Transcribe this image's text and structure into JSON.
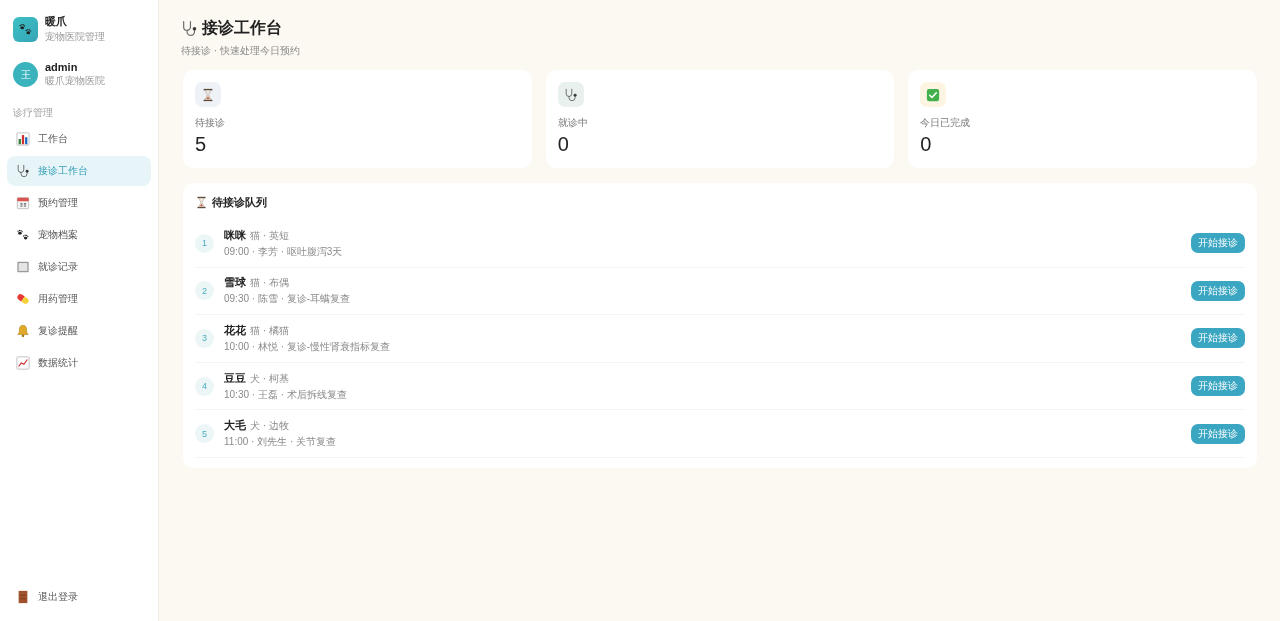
{
  "sidebar": {
    "brand": {
      "name": "暖爪",
      "subtitle": "宠物医院管理"
    },
    "user": {
      "avatar": "王",
      "name": "admin",
      "org": "暖爪宠物医院"
    },
    "section_label": "诊疗管理",
    "items": [
      {
        "kind": "bar-chart",
        "label": "工作台",
        "selected": false
      },
      {
        "kind": "stethoscope",
        "label": "接诊工作台",
        "selected": true
      },
      {
        "kind": "calendar",
        "label": "预约管理",
        "selected": false
      },
      {
        "kind": "paws",
        "label": "宠物档案",
        "selected": false
      },
      {
        "kind": "notebook",
        "label": "就诊记录",
        "selected": false
      },
      {
        "kind": "pill",
        "label": "用药管理",
        "selected": false
      },
      {
        "kind": "bell",
        "label": "复诊提醒",
        "selected": false
      },
      {
        "kind": "line-chart",
        "label": "数据统计",
        "selected": false
      }
    ],
    "logout": {
      "label": "退出登录"
    }
  },
  "page": {
    "title": "接诊工作台",
    "subtitle": "待接诊 · 快速处理今日预约"
  },
  "stats": [
    {
      "kind": "hourglass",
      "label": "待接诊",
      "value": "5"
    },
    {
      "kind": "stethoscope",
      "label": "就诊中",
      "value": "0"
    },
    {
      "kind": "check",
      "label": "今日已完成",
      "value": "0"
    }
  ],
  "queue": {
    "title": "待接诊队列",
    "rows": [
      {
        "number": "1",
        "name": "咪咪",
        "species": "猫 · 英短",
        "details": "09:00 · 李芳 · 呕吐腹泻3天",
        "button": "开始接诊"
      },
      {
        "number": "2",
        "name": "雪球",
        "species": "猫 · 布偶",
        "details": "09:30 · 陈雪 · 复诊-耳螨复查",
        "button": "开始接诊"
      },
      {
        "number": "3",
        "name": "花花",
        "species": "猫 · 橘猫",
        "details": "10:00 · 林悦 · 复诊-慢性肾衰指标复查",
        "button": "开始接诊"
      },
      {
        "number": "4",
        "name": "豆豆",
        "species": "犬 · 柯基",
        "details": "10:30 · 王磊 · 术后拆线复查",
        "button": "开始接诊"
      },
      {
        "number": "5",
        "name": "大毛",
        "species": "犬 · 边牧",
        "details": "11:00 · 刘先生 · 关节复查",
        "button": "开始接诊"
      }
    ]
  }
}
